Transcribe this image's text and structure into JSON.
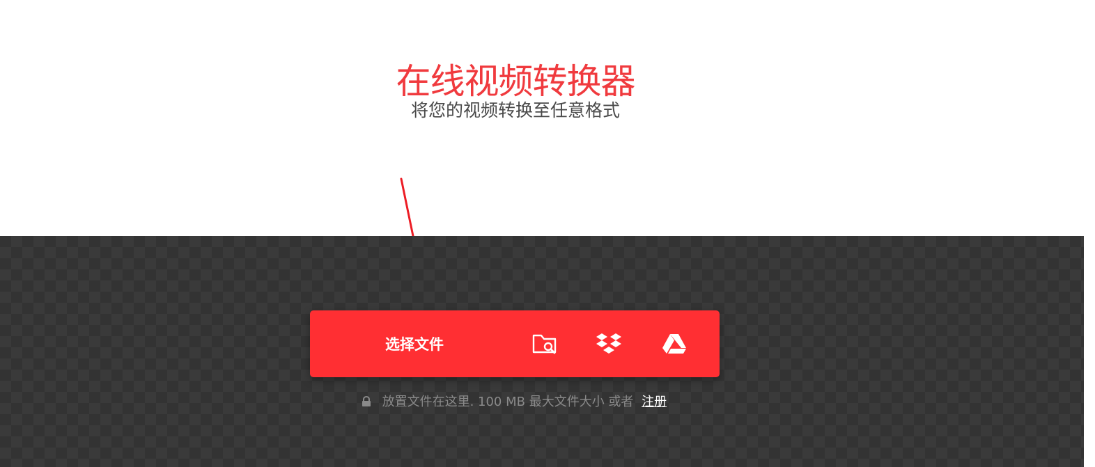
{
  "hero": {
    "title": "在线视频转换器",
    "subtitle": "将您的视频转换至任意格式"
  },
  "upload": {
    "choose_file_label": "选择文件",
    "sources": [
      {
        "name": "local-folder-search",
        "icon": "folder-search-icon"
      },
      {
        "name": "dropbox",
        "icon": "dropbox-icon"
      },
      {
        "name": "google-drive",
        "icon": "google-drive-icon"
      }
    ],
    "drop_hint": "放置文件在这里. 100 MB 最大文件大小 或者",
    "register_label": "注册"
  },
  "colors": {
    "accent": "#ff2f33",
    "title": "#f03a3e",
    "dark_bg": "#333333",
    "hint_text": "#8a8a8a",
    "annotation_arrow": "#ec1c24"
  }
}
